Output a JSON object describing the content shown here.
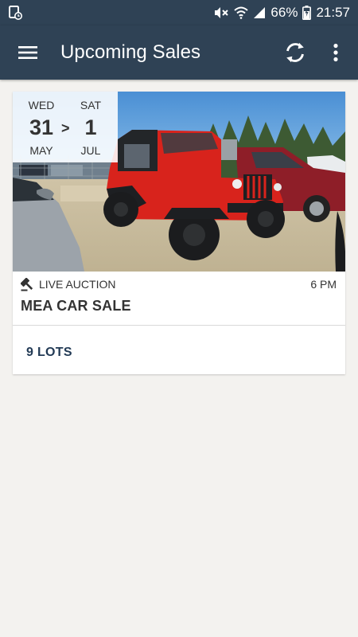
{
  "status_bar": {
    "battery_percent": "66%",
    "time": "21:57",
    "icons": [
      "screen-record-icon",
      "mute-vibrate-icon",
      "wifi-icon",
      "signal-icon",
      "battery-charging-icon"
    ]
  },
  "app_bar": {
    "title": "Upcoming Sales",
    "icons": [
      "menu-icon",
      "refresh-icon",
      "more-vert-icon"
    ]
  },
  "sale_card": {
    "start": {
      "weekday": "WED",
      "day": "31",
      "month": "MAY"
    },
    "arrow": ">",
    "end": {
      "weekday": "SAT",
      "day": "1",
      "month": "JUL"
    },
    "auction_type": "LIVE AUCTION",
    "auction_icon": "gavel-icon",
    "time": "6 PM",
    "name": "MEA CAR SALE",
    "lots": "9 LOTS",
    "image_subject": "red jeep photo"
  },
  "colors": {
    "app_bar": "#2f4255",
    "background": "#f3f2ef",
    "card": "#ffffff",
    "lots_text": "#223a55"
  }
}
